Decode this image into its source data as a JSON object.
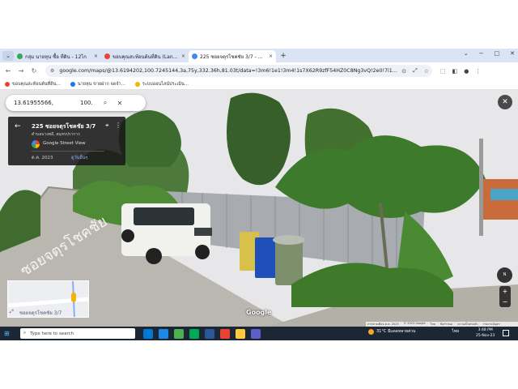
{
  "browser": {
    "tabs": [
      {
        "title": "กลุ่ม นายหุน ซื้อ ที่ดิน - 12ไก",
        "favicon_color": "#34a853",
        "active": false
      },
      {
        "title": "ขอบคุณสะท้อนต้นที่ดิน (LandMo)",
        "favicon_color": "#ea4335",
        "active": false
      },
      {
        "title": "225 ซอยจตุรโชคชัย 3/7 - Google",
        "favicon_color": "#4285f4",
        "active": true
      }
    ],
    "tab_menu_glyph": "⌄",
    "new_tab_glyph": "+",
    "close_glyph": "×",
    "window_controls": [
      "⌄",
      "−",
      "□",
      "✕"
    ],
    "nav": {
      "back": "←",
      "forward": "→",
      "reload": "↻"
    },
    "url": "google.com/maps/@13.6194202,100.7245144,3a,75y,332.36h,81.03t/data=!3m6!1e1!3m4!1s7X62R9zfF54HZ0C8Ng3vQ!2e0!7i16384!8i8192!5m2!1e1!1e4?en...",
    "omnibox_actions": [
      "⊙",
      "⤢",
      "☆"
    ],
    "toolbar_right": [
      "⬚",
      "◧",
      "●",
      "⋮"
    ],
    "bookmarks": [
      {
        "label": "ขอบคุณสะท้อนต้นที่ดิน...",
        "color": "#ea4335"
      },
      {
        "label": "นายหุน ขายฝาก จดจำ...",
        "color": "#1877f2"
      },
      {
        "label": "ระบบออนไลน์ประเมิน...",
        "color": "#f4b400"
      }
    ]
  },
  "maps": {
    "search": {
      "query": "13.61955566,",
      "query2": "100.",
      "search_icon": "⌕",
      "clear_icon": "✕"
    },
    "card": {
      "back_glyph": "←",
      "address": "225 ซอยจตุรโชคชัย 3/7",
      "region": "ตำบลบางพลี, สมุทรปราการ",
      "pin_glyph": "⌖",
      "more_glyph": "⋮",
      "source": "Google Street View",
      "date": "ต.ค. 2023",
      "see_more": "ดูวันอื่นๆ"
    },
    "close_glyph": "✕",
    "minimap": {
      "road_label": "ซอยจตุรโชคชัย 3/7",
      "expand_glyph": "⤢"
    },
    "compass_label": "N",
    "zoom": {
      "plus": "+",
      "minus": "−"
    },
    "logo": "Google",
    "attribution": [
      "ภาพถ่ายเดือน ต.ค. 2023",
      "© 2023 Google",
      "ไทย",
      "ข้อกำหนด",
      "ความเป็นส่วนตัว",
      "รายงานปัญหา"
    ]
  },
  "taskbar": {
    "start_glyph": "⊞",
    "search_placeholder": "Type here to search",
    "search_glyph": "⌕",
    "apps": [
      "#0078d4",
      "#1e88e5",
      "#4caf50",
      "#00a859",
      "#2b579a",
      "#ea4335",
      "#ffc83d",
      "#5b5fc7"
    ],
    "weather": "31°C มีแดดหลายส่วน",
    "tray_lang": "ไทย",
    "time": "3:48 PM",
    "date": "25-Nov-23",
    "notification_glyph": "▢"
  },
  "colors": {
    "sky": "#e7e7e9",
    "foliage": "#3f6b2e",
    "fence": "#a7aaae",
    "road": "#b9b6af",
    "truck": "#f2f2f0",
    "bin_blue": "#1f4fb8",
    "bin_green": "#7e8f6d"
  }
}
